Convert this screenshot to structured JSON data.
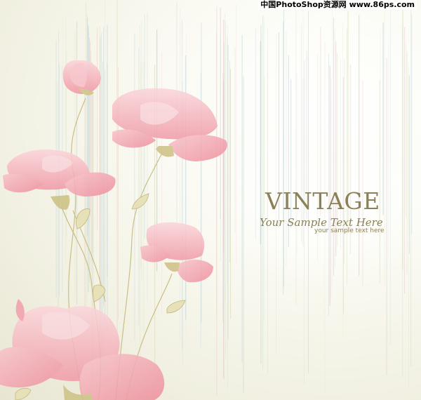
{
  "watermark": {
    "text": "中国PhotoShop资源网 www.86ps.com"
  },
  "heading": {
    "title": "VINTAGE",
    "script_line": "Your Sample Text Here",
    "subtitle": "your sample text here"
  },
  "colors": {
    "text": "#8b8058",
    "petal_light": "#f6c9cf",
    "petal_mid": "#f29fab",
    "petal_deep": "#ef8b98",
    "stem": "#c9bf86",
    "lines": "#b9d0d6"
  }
}
